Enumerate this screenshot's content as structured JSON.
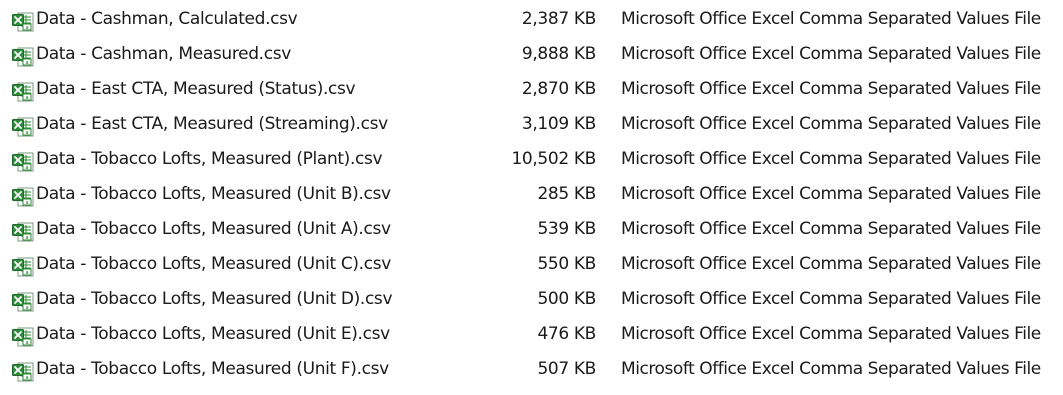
{
  "files": [
    {
      "name": "Data - Cashman, Calculated.csv",
      "size": "2,387 KB",
      "type": "Microsoft Office Excel Comma Separated Values File",
      "icon": "excel-csv-icon"
    },
    {
      "name": "Data - Cashman, Measured.csv",
      "size": "9,888 KB",
      "type": "Microsoft Office Excel Comma Separated Values File",
      "icon": "excel-csv-icon"
    },
    {
      "name": "Data - East CTA, Measured (Status).csv",
      "size": "2,870 KB",
      "type": "Microsoft Office Excel Comma Separated Values File",
      "icon": "excel-csv-icon"
    },
    {
      "name": "Data - East CTA, Measured (Streaming).csv",
      "size": "3,109 KB",
      "type": "Microsoft Office Excel Comma Separated Values File",
      "icon": "excel-csv-icon"
    },
    {
      "name": "Data - Tobacco Lofts, Measured (Plant).csv",
      "size": "10,502 KB",
      "type": "Microsoft Office Excel Comma Separated Values File",
      "icon": "excel-csv-icon"
    },
    {
      "name": "Data - Tobacco Lofts, Measured (Unit B).csv",
      "size": "285 KB",
      "type": "Microsoft Office Excel Comma Separated Values File",
      "icon": "excel-csv-icon"
    },
    {
      "name": "Data - Tobacco Lofts, Measured (Unit A).csv",
      "size": "539 KB",
      "type": "Microsoft Office Excel Comma Separated Values File",
      "icon": "excel-csv-icon"
    },
    {
      "name": "Data - Tobacco Lofts, Measured (Unit C).csv",
      "size": "550 KB",
      "type": "Microsoft Office Excel Comma Separated Values File",
      "icon": "excel-csv-icon"
    },
    {
      "name": "Data - Tobacco Lofts, Measured (Unit D).csv",
      "size": "500 KB",
      "type": "Microsoft Office Excel Comma Separated Values File",
      "icon": "excel-csv-icon"
    },
    {
      "name": "Data - Tobacco Lofts, Measured (Unit E).csv",
      "size": "476 KB",
      "type": "Microsoft Office Excel Comma Separated Values File",
      "icon": "excel-csv-icon"
    },
    {
      "name": "Data - Tobacco Lofts, Measured (Unit F).csv",
      "size": "507 KB",
      "type": "Microsoft Office Excel Comma Separated Values File",
      "icon": "excel-csv-icon"
    }
  ],
  "colors": {
    "text": "#1a1a1a",
    "icon_green": "#2e8b3a",
    "icon_dark_green": "#1e6b2a",
    "icon_paper": "#ffffff",
    "icon_border": "#7a9a7e"
  }
}
